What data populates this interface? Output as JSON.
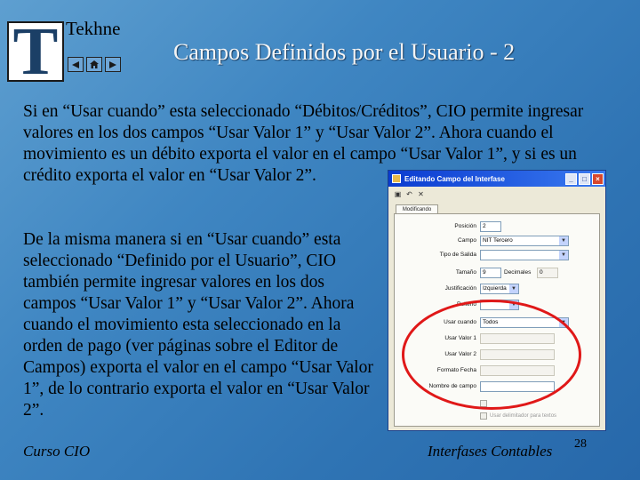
{
  "brand": "Tekhne",
  "logo_letter": "T",
  "slide_title": "Campos Definidos por el Usuario - 2",
  "paragraph1": "Si en “Usar cuando” esta seleccionado “Débitos/Créditos”, CIO permite ingresar valores en los dos campos “Usar Valor 1” y “Usar Valor 2”. Ahora cuando el movimiento es un débito exporta el valor en el campo “Usar Valor 1”, y si es un crédito exporta el valor en “Usar Valor 2”.",
  "paragraph2": "De la misma manera si en “Usar cuando” esta seleccionado “Definido por el Usuario”, CIO también permite ingresar valores en los dos campos “Usar Valor 1” y “Usar Valor 2”. Ahora cuando el movimiento esta seleccionado en la orden de pago (ver páginas sobre el Editor de Campos) exporta el valor en el campo “Usar Valor 1”, de lo contrario exporta el valor en “Usar Valor 2”.",
  "footer": {
    "left": "Curso CIO",
    "right": "Interfases Contables",
    "page": "28"
  },
  "nav_icons": [
    "prev-arrow-icon",
    "home-icon",
    "next-arrow-icon"
  ],
  "dialog": {
    "title": "Editando Campo del Interfase",
    "tab": "Modificando",
    "fields": {
      "posicion": {
        "label": "Posición",
        "value": "2"
      },
      "campo": {
        "label": "Campo",
        "value": "NIT Tercero"
      },
      "tipo_salida": {
        "label": "Tipo de Salida",
        "value": ""
      },
      "tamano": {
        "label": "Tamaño",
        "value": "9"
      },
      "decimales": {
        "label": "Decimales",
        "value": "0"
      },
      "justificacion": {
        "label": "Justificación",
        "value": "Izquierda"
      },
      "relleno": {
        "label": "Relleno",
        "value": ""
      },
      "usar_cuando": {
        "label": "Usar cuando",
        "value": "Todos"
      },
      "usar_valor1": {
        "label": "Usar Valor 1",
        "value": ""
      },
      "usar_valor2": {
        "label": "Usar Valor 2",
        "value": ""
      },
      "formato_fecha": {
        "label": "Formato Fecha",
        "value": ""
      },
      "nombre_campo": {
        "label": "Nombre de campo",
        "value": ""
      }
    },
    "checkbox_label": "Usar delimitador para textos"
  },
  "colors": {
    "background": "#3f86c2",
    "title_text": "#f4f4f4",
    "highlight": "#e01818",
    "dialog_titlebar": "#0a3bd0"
  }
}
